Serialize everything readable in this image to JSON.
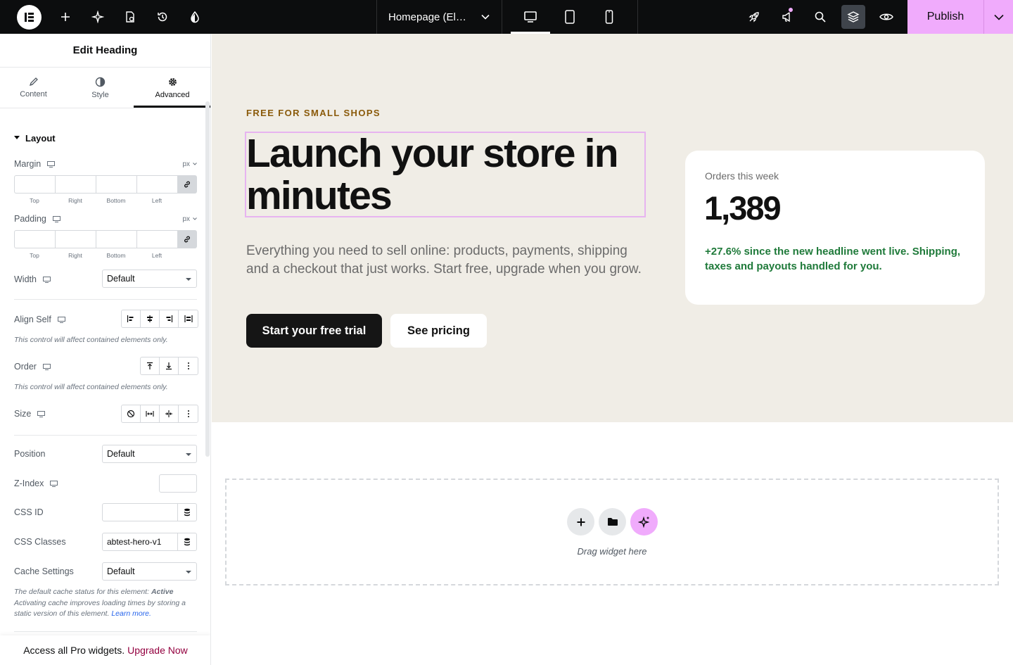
{
  "topbar": {
    "document_title": "Homepage (Ele…",
    "publish_label": "Publish"
  },
  "panel": {
    "title": "Edit Heading",
    "tabs": [
      {
        "label": "Content",
        "icon": "pencil-icon"
      },
      {
        "label": "Style",
        "icon": "contrast-icon"
      },
      {
        "label": "Advanced",
        "icon": "gear-icon"
      }
    ],
    "active_tab": "Advanced",
    "section_title": "Layout",
    "margin": {
      "label": "Margin",
      "unit": "px",
      "sides": [
        "Top",
        "Right",
        "Bottom",
        "Left"
      ]
    },
    "padding": {
      "label": "Padding",
      "unit": "px",
      "sides": [
        "Top",
        "Right",
        "Bottom",
        "Left"
      ]
    },
    "width": {
      "label": "Width",
      "value": "Default"
    },
    "align_self": {
      "label": "Align Self",
      "hint": "This control will affect contained elements only."
    },
    "order": {
      "label": "Order",
      "hint": "This control will affect contained elements only."
    },
    "size": {
      "label": "Size"
    },
    "position": {
      "label": "Position",
      "value": "Default"
    },
    "z_index": {
      "label": "Z-Index",
      "value": ""
    },
    "css_id": {
      "label": "CSS ID",
      "value": ""
    },
    "css_classes": {
      "label": "CSS Classes",
      "value": "abtest-hero-v1"
    },
    "cache": {
      "label": "Cache Settings",
      "value": "Default",
      "hint_prefix": "The default cache status for this element: ",
      "hint_status": "Active",
      "hint_body": "Activating cache improves loading times by storing a static version of this element. ",
      "hint_link": "Learn more."
    },
    "pro_bar": {
      "text": "Access all Pro widgets.",
      "link": "Upgrade Now"
    }
  },
  "hero": {
    "eyebrow": "FREE FOR SMALL SHOPS",
    "headline": "Launch your store in minutes",
    "subtext": "Everything you need to sell online: products, payments, shipping and a checkout that just works. Start free, upgrade when you grow.",
    "primary_button": "Start your free trial",
    "secondary_button": "See pricing"
  },
  "stat_card": {
    "label": "Orders this week",
    "value": "1,389",
    "note": "+27.6% since the new headline went live. Shipping, taxes and payouts handled for you."
  },
  "dropzone": {
    "text": "Drag widget here"
  },
  "colors": {
    "topbar": "#0c0d0e",
    "publish": "#f0abfc",
    "hero_bg": "#f0ede6",
    "eyebrow": "#8a5a0a",
    "stat_note": "#1f7a3a",
    "upgrade_link": "#93003f"
  }
}
